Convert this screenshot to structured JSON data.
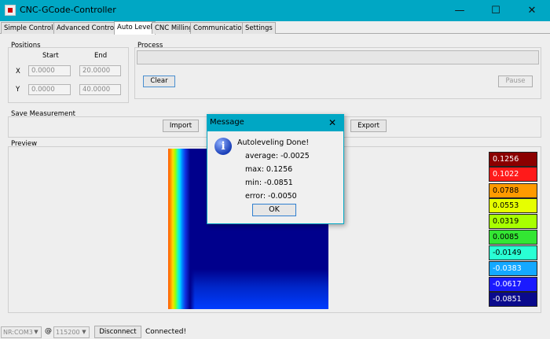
{
  "window": {
    "title": "CNC-GCode-Controller"
  },
  "tabs": [
    {
      "label": "Simple Controls"
    },
    {
      "label": "Advanced Controls"
    },
    {
      "label": "Auto Level"
    },
    {
      "label": "CNC Milling"
    },
    {
      "label": "Communication"
    },
    {
      "label": "Settings"
    }
  ],
  "positions": {
    "title": "Positions",
    "start_label": "Start",
    "end_label": "End",
    "x_label": "X",
    "y_label": "Y",
    "x_start": "0.0000",
    "x_end": "20.0000",
    "y_start": "0.0000",
    "y_end": "40.0000"
  },
  "process": {
    "title": "Process",
    "progress": 0,
    "clear_label": "Clear",
    "pause_label": "Pause"
  },
  "save": {
    "title": "Save Measurement",
    "import_label": "Import",
    "export_label": "Export"
  },
  "preview": {
    "title": "Preview",
    "legend": [
      {
        "value": "0.1256",
        "color": "#8b0000",
        "text_color": "#ffffff"
      },
      {
        "value": "0.1022",
        "color": "#ff1a1a",
        "text_color": "#ffffff"
      },
      {
        "value": "0.0788",
        "color": "#ff9a00",
        "text_color": "#000000"
      },
      {
        "value": "0.0553",
        "color": "#e6ff00",
        "text_color": "#000000"
      },
      {
        "value": "0.0319",
        "color": "#a8ff00",
        "text_color": "#000000"
      },
      {
        "value": "0.0085",
        "color": "#33e633",
        "text_color": "#000000"
      },
      {
        "value": "-0.0149",
        "color": "#29ffd4",
        "text_color": "#000000"
      },
      {
        "value": "-0.0383",
        "color": "#14a8ff",
        "text_color": "#ffffff"
      },
      {
        "value": "-0.0617",
        "color": "#1a1aff",
        "text_color": "#ffffff"
      },
      {
        "value": "-0.0851",
        "color": "#0a0a8c",
        "text_color": "#ffffff"
      }
    ]
  },
  "dialog": {
    "title": "Message",
    "heading": "Autoleveling Done!",
    "average": "average: -0.0025",
    "max": "max: 0.1256",
    "min": "min: -0.0851",
    "error": "error: -0.0050",
    "ok_label": "OK"
  },
  "statusbar": {
    "port": "NR:COM3",
    "at": "@",
    "baud": "115200",
    "disconnect_label": "Disconnect",
    "status": "Connected!"
  },
  "colors": {
    "accent": "#00a7c4"
  }
}
